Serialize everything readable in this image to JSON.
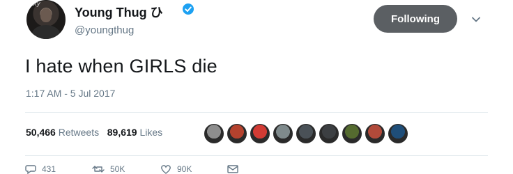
{
  "header": {
    "avatar_tag": "story",
    "display_name": "Young Thug ひ",
    "handle": "@youngthug",
    "follow_label": "Following"
  },
  "tweet": {
    "text": "I hate when GIRLS die",
    "timestamp": "1:17 AM - 5 Jul 2017"
  },
  "stats": {
    "retweets_count": "50,466",
    "retweets_label": "Retweets",
    "likes_count": "89,619",
    "likes_label": "Likes"
  },
  "liker_avatars": [
    "#8d8d8d",
    "#b5422e",
    "#d23b34",
    "#7f8a8c",
    "#4a5157",
    "#3c3f42",
    "#556b2f",
    "#b14a3a",
    "#1f4e79"
  ],
  "actions": {
    "reply_count": "431",
    "retweet_count": "50K",
    "like_count": "90K"
  },
  "colors": {
    "verified": "#1da1f2",
    "following_button": "#5b5f63",
    "secondary_text": "#657786"
  }
}
